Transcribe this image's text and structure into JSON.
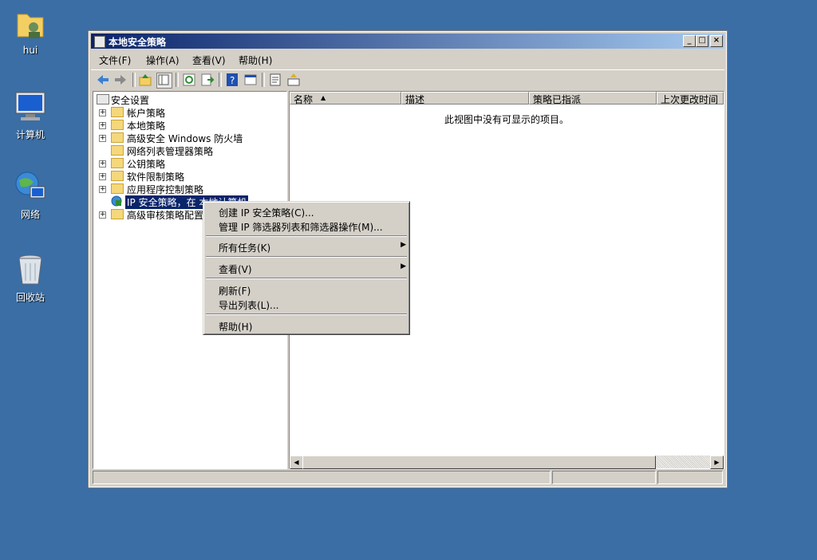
{
  "desktop": {
    "icons": [
      {
        "label": "hui",
        "icon": "user-folder-icon"
      },
      {
        "label": "计算机",
        "icon": "computer-icon"
      },
      {
        "label": "网络",
        "icon": "network-icon"
      },
      {
        "label": "回收站",
        "icon": "recycle-bin-icon"
      }
    ]
  },
  "window": {
    "title": "本地安全策略",
    "controls": {
      "minimize": "_",
      "maximize": "□",
      "close": "×"
    },
    "menu": [
      "文件(F)",
      "操作(A)",
      "查看(V)",
      "帮助(H)"
    ],
    "toolbar": [
      "back-icon",
      "forward-icon",
      "up-icon",
      "show-hide-tree-icon",
      "refresh-icon",
      "export-list-icon",
      "help-icon",
      "properties-icon",
      "new-policy-icon",
      "manage-filters-icon"
    ],
    "tree": [
      {
        "label": "安全设置",
        "expander": ""
      },
      {
        "label": "帐户策略",
        "expander": "+"
      },
      {
        "label": "本地策略",
        "expander": "+"
      },
      {
        "label": "高级安全 Windows 防火墙",
        "expander": "+"
      },
      {
        "label": "网络列表管理器策略",
        "expander": ""
      },
      {
        "label": "公钥策略",
        "expander": "+"
      },
      {
        "label": "软件限制策略",
        "expander": "+"
      },
      {
        "label": "应用程序控制策略",
        "expander": "+"
      },
      {
        "label": "IP 安全策略，在 本地计算机",
        "expander": ""
      },
      {
        "label": "高级审核策略配置",
        "expander": "+"
      }
    ],
    "columns": [
      "名称",
      "描述",
      "策略已指派",
      "上次更改时间"
    ],
    "empty_message": "此视图中没有可显示的项目。",
    "accent": "#0a246a"
  },
  "context_menu": {
    "items": [
      {
        "label": "创建 IP 安全策略(C)..."
      },
      {
        "label": "管理 IP 筛选器列表和筛选器操作(M)..."
      },
      {
        "label": "所有任务(K)"
      },
      {
        "label": "查看(V)"
      },
      {
        "label": "刷新(F)"
      },
      {
        "label": "导出列表(L)..."
      },
      {
        "label": "帮助(H)"
      }
    ]
  }
}
